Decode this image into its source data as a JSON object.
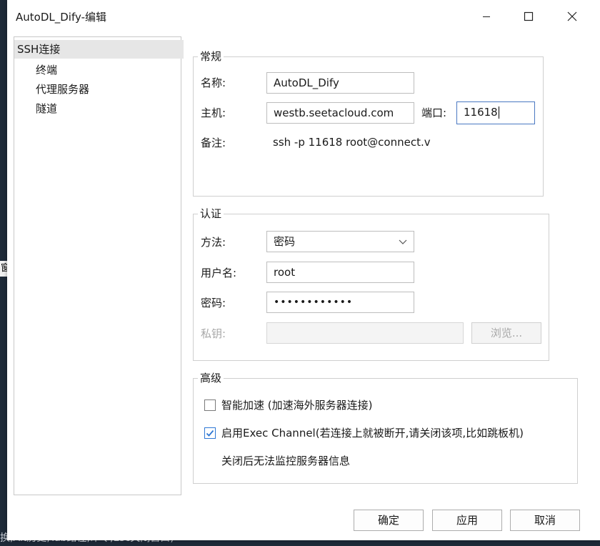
{
  "window": {
    "title": "AutoDL_Dify-编辑",
    "minimize_label": "",
    "maximize_label": "",
    "close_label": ""
  },
  "nav": {
    "root": "SSH连接",
    "children": [
      "终端",
      "代理服务器",
      "隧道"
    ]
  },
  "general": {
    "legend": "常规",
    "name_label": "名称:",
    "name_value": "AutoDL_Dify",
    "host_label": "主机:",
    "host_value": "westb.seetacloud.com",
    "port_label": "端口:",
    "port_value": "11618",
    "note_label": "备注:",
    "note_value": "ssh -p 11618 root@connect.v"
  },
  "auth": {
    "legend": "认证",
    "method_label": "方法:",
    "method_value": "密码",
    "user_label": "用户名:",
    "user_value": "root",
    "password_label": "密码:",
    "password_value": "••••••••••••",
    "key_label": "私钥:",
    "key_value": "",
    "browse_label": "浏览..."
  },
  "advanced": {
    "legend": "高级",
    "smart_accel_label": "智能加速 (加速海外服务器连接)",
    "smart_accel_checked": false,
    "exec_channel_label": "启用Exec Channel(若连接上就被断开,请关闭该项,比如跳板机)",
    "exec_channel_checked": true,
    "exec_channel_note": "关闭后无法监控服务器信息"
  },
  "buttons": {
    "ok": "确定",
    "apply": "应用",
    "cancel": "取消"
  },
  "background": {
    "peek_text": "窗",
    "bottom_text": "换,Alt历史,Tab路径,命令,Esc关闭窗口)"
  },
  "colors": {
    "accent": "#2f78d4",
    "focus_border": "#4a78c2",
    "selected_nav": "#e6e6e6",
    "desktop": "#1e2a38"
  }
}
